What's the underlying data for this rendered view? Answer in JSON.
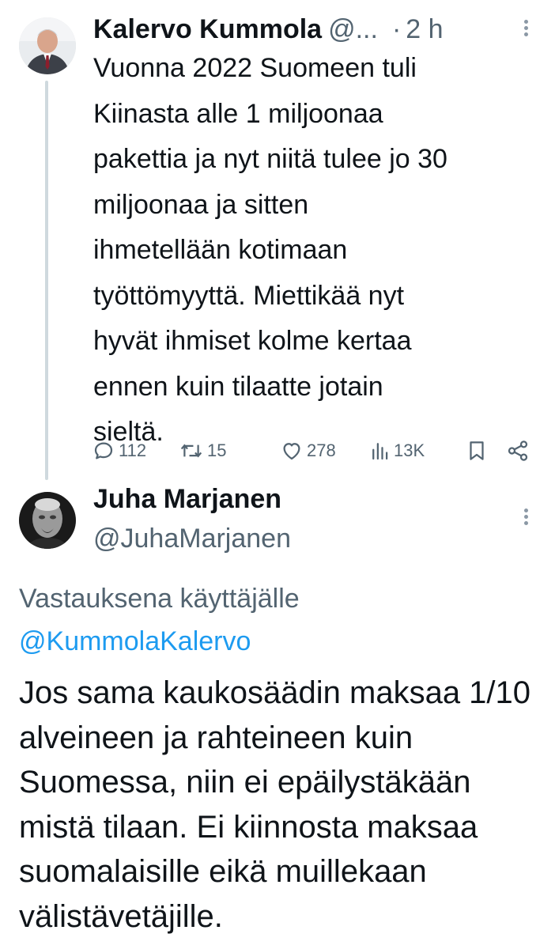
{
  "parent_tweet": {
    "author_name": "Kalervo Kummola",
    "handle_truncated": "@...",
    "separator": "·",
    "time": "2 h",
    "avatar_icon": "person-photo-avatar",
    "text": "Vuonna 2022 Suomeen tuli\nKiinasta alle 1 miljoonaa\npakettia ja nyt niitä tulee jo 30\nmiljoonaa ja sitten\nihmetellään kotimaan\ntyöttömyyttä. Miettikää nyt\nhyvät ihmiset kolme kertaa\nennen kuin tilaatte jotain\nsieltä.",
    "actions": {
      "replies": "112",
      "reposts": "15",
      "likes": "278",
      "views": "13K"
    }
  },
  "reply_tweet": {
    "author_name": "Juha Marjanen",
    "handle": "@JuhaMarjanen",
    "avatar_icon": "person-photo-avatar",
    "replying_to_prefix": "Vastauksena käyttäjälle ",
    "replying_to_mention": "@KummolaKalervo",
    "text": "Jos sama kaukosäädin maksaa 1/10 alveineen ja rahteineen kuin Suomessa, niin ei epäilystäkään mistä tilaan. Ei kiinnosta maksaa suomalaisille eikä muillekaan välistävetäjille."
  },
  "colors": {
    "text_primary": "#0f1419",
    "text_secondary": "#536471",
    "link": "#1d9bf0",
    "thread_line": "#cfd9de"
  }
}
